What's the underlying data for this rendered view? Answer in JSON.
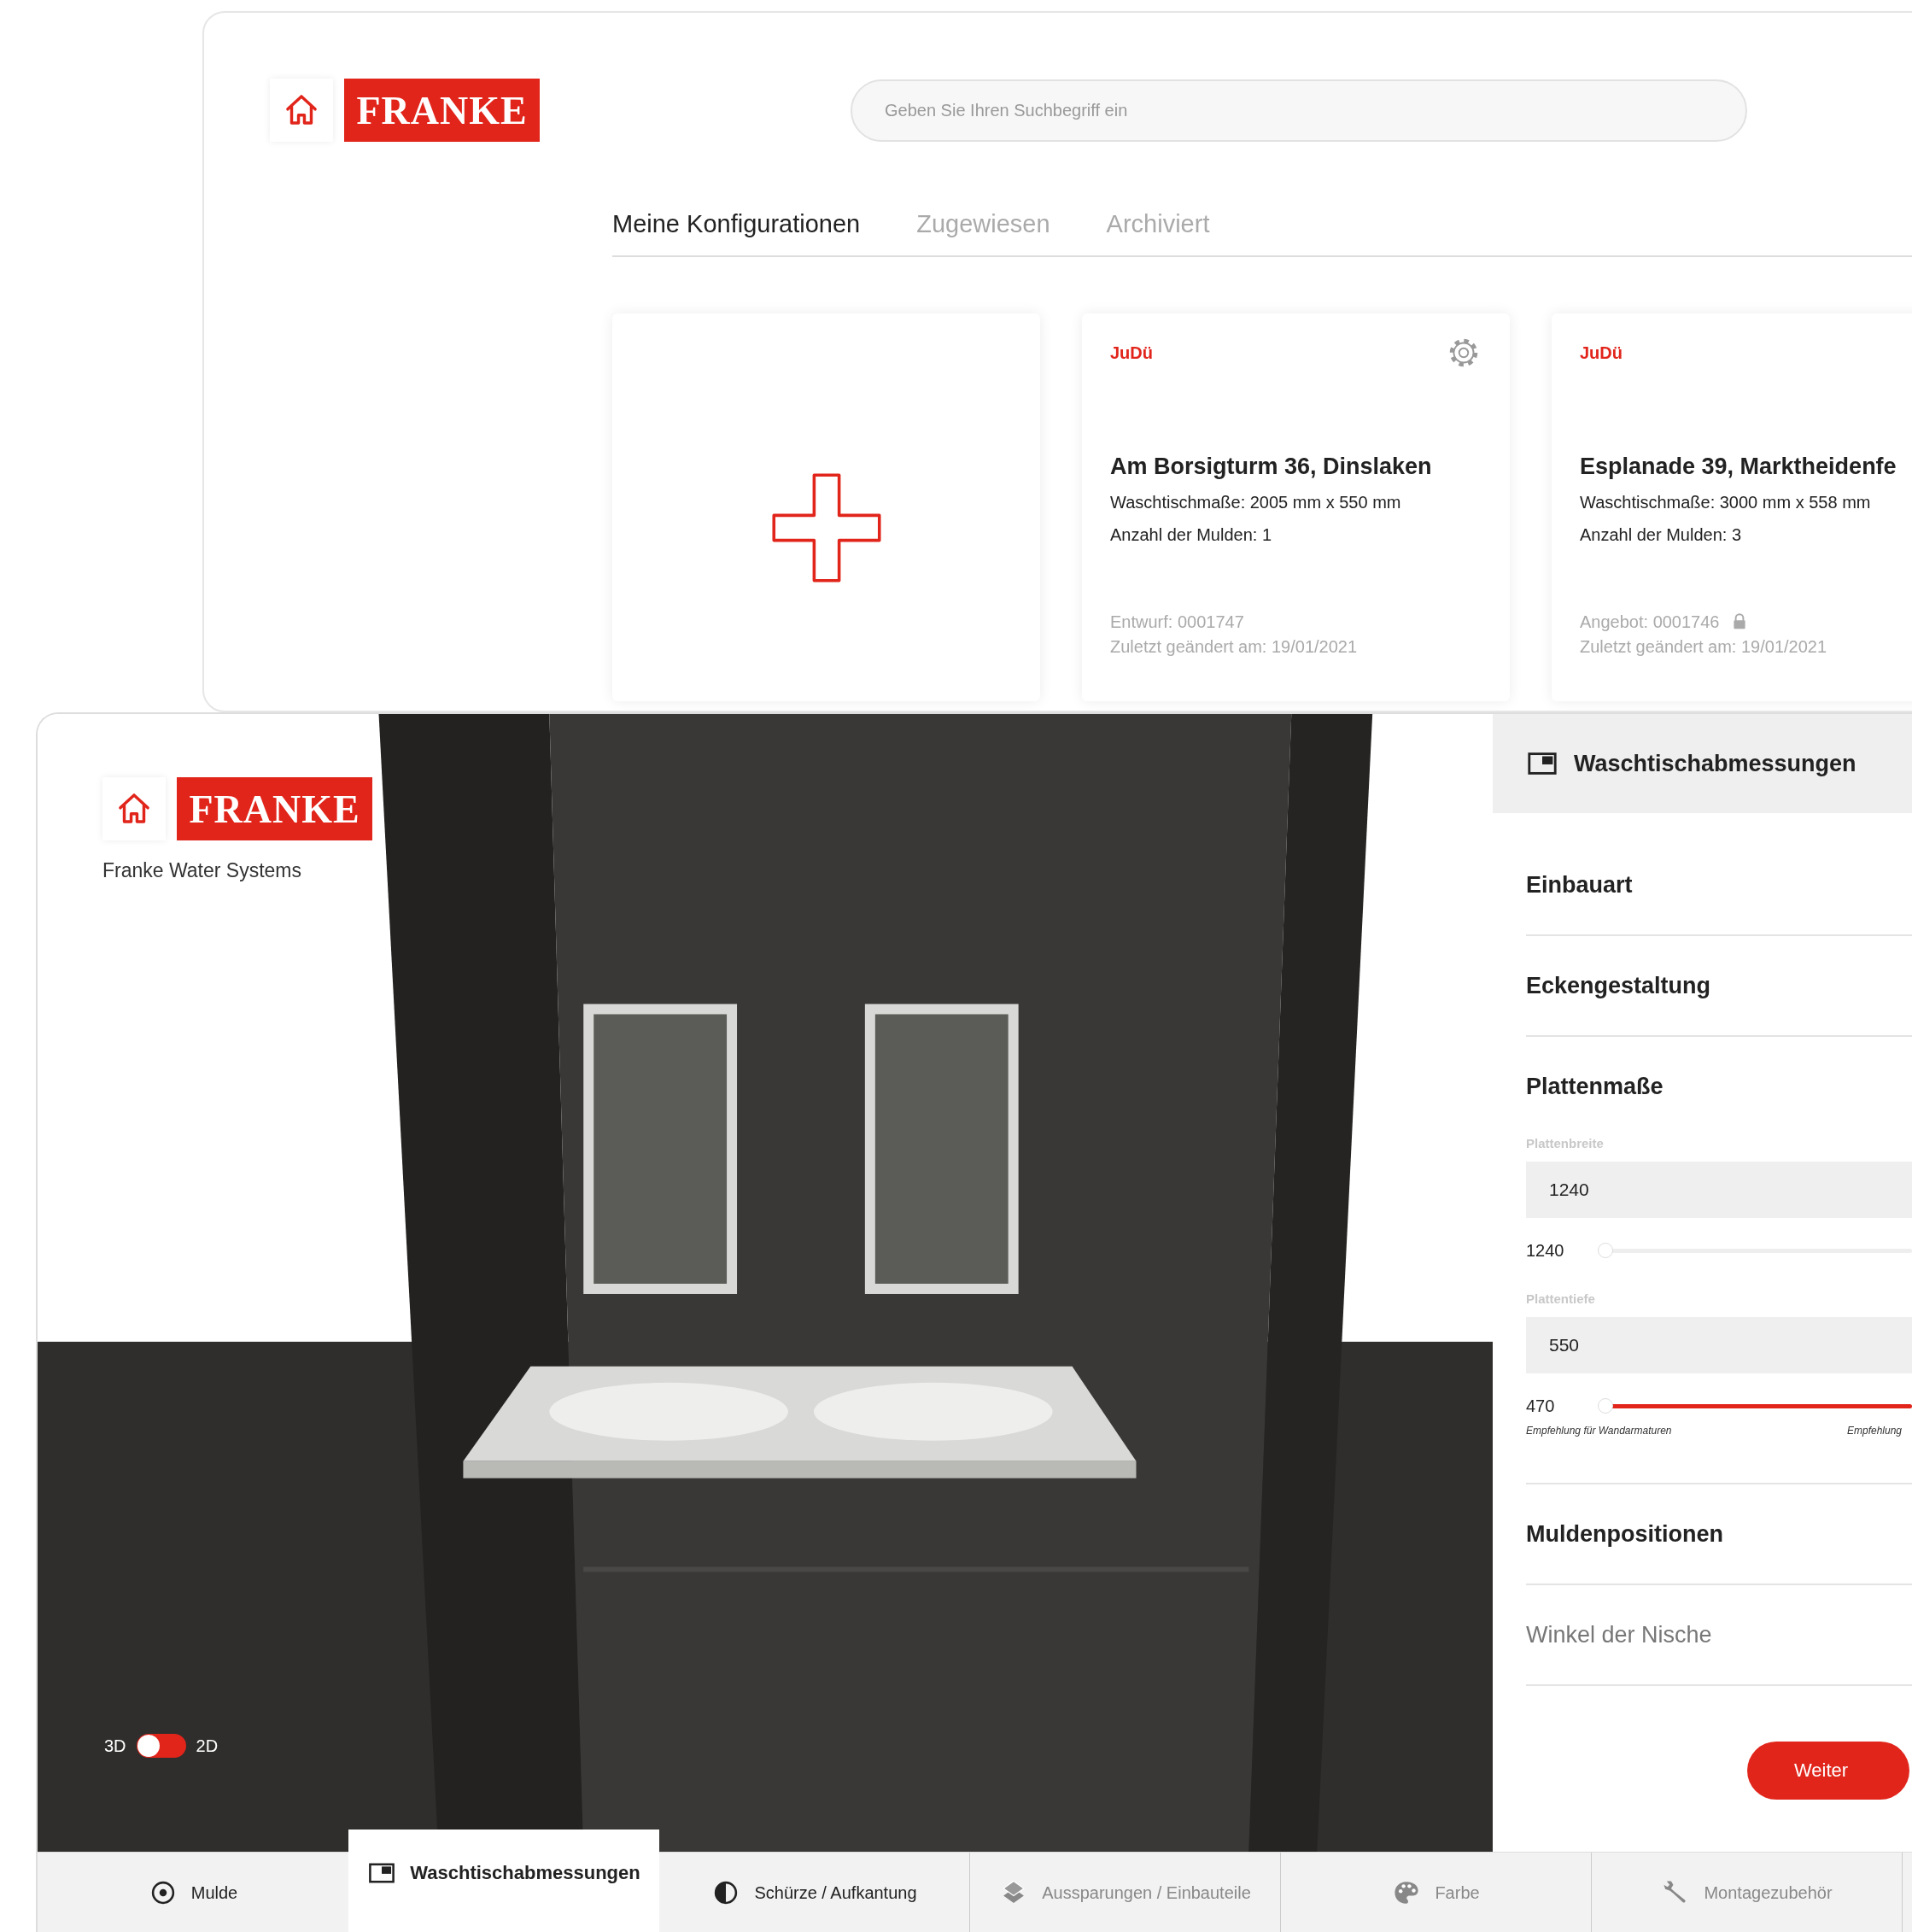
{
  "back_window": {
    "brand": {
      "logo": "FRANKE"
    },
    "search": {
      "placeholder": "Geben Sie Ihren Suchbegriff ein"
    },
    "tabs": [
      {
        "label": "Meine Konfigurationen",
        "selected": true
      },
      {
        "label": "Zugewiesen",
        "selected": false
      },
      {
        "label": "Archiviert",
        "selected": false
      }
    ],
    "cards": [
      {
        "kind": "new"
      },
      {
        "kind": "config",
        "owner": "JuDü",
        "settings": true,
        "title": "Am Borsigturm 36, Dinslaken",
        "lines": [
          "Waschtischmaße: 2005 mm x 550 mm",
          "Anzahl der Mulden: 1"
        ],
        "number": "Entwurf: 0001747",
        "locked": false,
        "modified": "Zuletzt geändert am: 19/01/2021"
      },
      {
        "kind": "config",
        "owner": "JuDü",
        "settings": false,
        "title": "Esplanade 39, Marktheidenfe",
        "lines": [
          "Waschtischmaße: 3000 mm x 558 mm",
          "Anzahl der Mulden: 3"
        ],
        "number": "Angebot: 0001746",
        "locked": true,
        "modified": "Zuletzt geändert am: 19/01/2021"
      }
    ]
  },
  "front_window": {
    "brand": {
      "logo": "FRANKE",
      "subtitle": "Franke Water Systems"
    },
    "view_toggle": {
      "left_label": "3D",
      "right_label": "2D",
      "right_on": false
    },
    "panel": {
      "title": "Waschtischabmessungen",
      "sections": [
        {
          "title": "Einbauart",
          "disabled": false
        },
        {
          "title": "Eckengestaltung",
          "disabled": false
        },
        {
          "title": "Plattenmaße",
          "disabled": false,
          "fields": [
            {
              "label": "Plattenbreite",
              "value": "1240",
              "slider": {
                "reading": "1240",
                "level": 0,
                "highlighted": false
              }
            },
            {
              "label": "Plattentiefe",
              "value": "550",
              "slider": {
                "reading": "470",
                "level": 0,
                "highlighted": true
              },
              "captions": [
                "Empfehlung für Wandarmaturen",
                "Empfehlung"
              ]
            }
          ]
        },
        {
          "title": "Muldenpositionen",
          "disabled": false
        },
        {
          "title": "Winkel der Nische",
          "disabled": true
        }
      ],
      "next_button": "Weiter"
    },
    "bottom_tabs": [
      {
        "kind": "radio",
        "label": "Mulde",
        "selected": false,
        "disabled": false
      },
      {
        "kind": "window",
        "label": "Waschtischabmessungen",
        "selected": true,
        "disabled": false
      },
      {
        "kind": "contrast",
        "label": "Schürze / Aufkantung",
        "selected": false,
        "disabled": false
      },
      {
        "kind": "layers",
        "label": "Aussparungen / Einbauteile",
        "selected": false,
        "disabled": true
      },
      {
        "kind": "palette",
        "label": "Farbe",
        "selected": false,
        "disabled": true
      },
      {
        "kind": "wrench",
        "label": "Montagezubehör",
        "selected": false,
        "disabled": true
      }
    ]
  }
}
